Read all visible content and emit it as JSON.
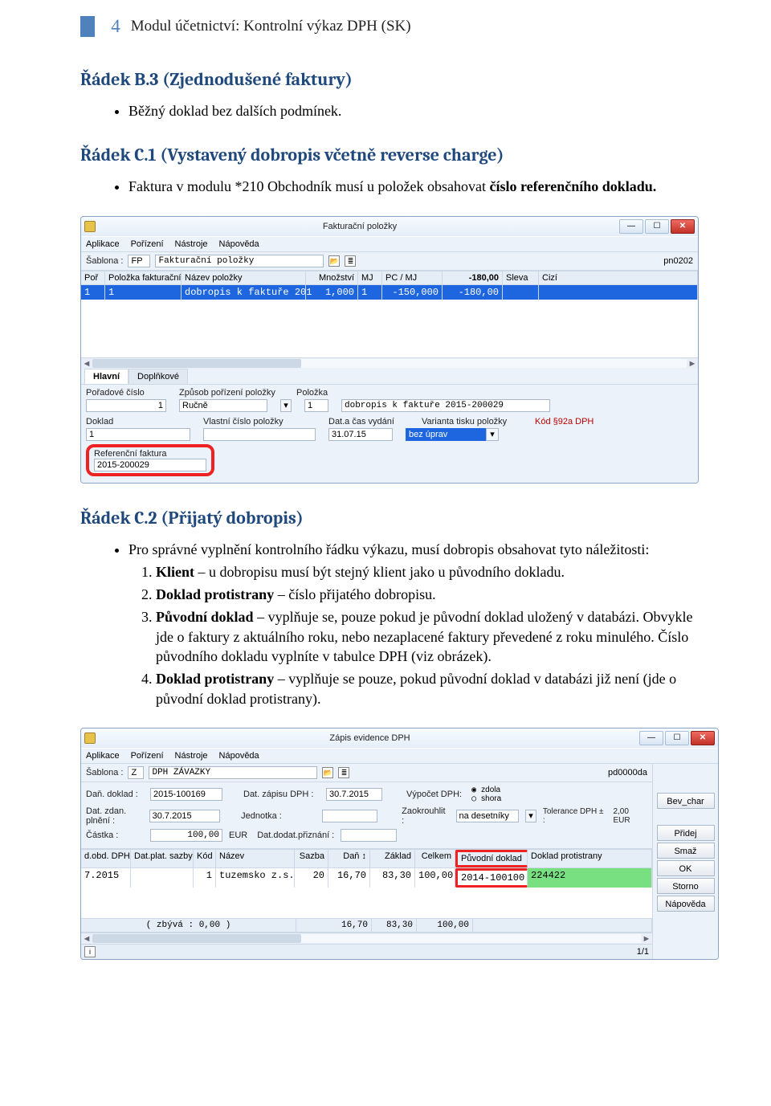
{
  "header": {
    "page_num": "4",
    "title": "Modul účetnictví: Kontrolní výkaz DPH (SK)"
  },
  "section_b3": {
    "title": "Řádek B.3 (Zjednodušené faktury)",
    "bullet": "Běžný doklad bez dalších podmínek."
  },
  "section_c1": {
    "title": "Řádek C.1 (Vystavený dobropis včetně reverse charge)",
    "bullet_pre": "Faktura v modulu *210 Obchodník musí u položek obsahovat ",
    "bullet_bold": "číslo referenčního dokladu."
  },
  "win1": {
    "title": "Fakturační položky",
    "menus": [
      "Aplikace",
      "Pořízení",
      "Nástroje",
      "Nápověda"
    ],
    "template_lbl": "Šablona :",
    "template_code": "FP",
    "template_name": "Fakturační položky",
    "tag": "pn0202",
    "cols": [
      "Poř",
      "Položka fakturační",
      "Název položky",
      "Množství",
      "MJ",
      "PC / MJ",
      "-180,00",
      "Sleva",
      "Cizí"
    ],
    "row": [
      "1",
      "1",
      "dobropis  k faktuře 201",
      "1,000",
      "1",
      "-150,000",
      "-180,00",
      "",
      ""
    ],
    "tabs": [
      "Hlavní",
      "Doplňkové"
    ],
    "fields": {
      "poradove_cislo_lbl": "Pořadové číslo",
      "poradove_cislo_val": "1",
      "zpusob_lbl": "Způsob pořízení položky",
      "zpusob_val": "Ručně",
      "polozka_lbl": "Položka",
      "polozka_val": "1",
      "polozka_text": "dobropis  k faktuře 2015-200029",
      "doklad_lbl": "Doklad",
      "doklad_val": "1",
      "vlastni_cislo_lbl": "Vlastní číslo položky",
      "dat_lbl": "Dat.a čas vydání",
      "dat_val": "31.07.15",
      "varianta_lbl": "Varianta tisku položky",
      "varianta_val": "bez úprav",
      "kod_lbl": "Kód §92a DPH",
      "ref_lbl": "Referenční faktura",
      "ref_val": "2015-200029"
    }
  },
  "section_c2": {
    "title": "Řádek C.2 (Přijatý dobropis)",
    "intro": "Pro správné vyplnění kontrolního řádku výkazu, musí dobropis obsahovat tyto náležitosti:",
    "items": [
      {
        "b": "Klient",
        "rest": " – u dobropisu musí být stejný klient jako u původního dokladu."
      },
      {
        "b": "Doklad protistrany",
        "rest": " – číslo přijatého dobropisu."
      },
      {
        "b": "Původní doklad",
        "rest": " – vyplňuje se, pouze pokud je původní doklad uložený v databázi. Obvykle jde o faktury z aktuálního roku, nebo nezaplacené faktury převedené z roku minulého. Číslo původního dokladu vyplníte v tabulce DPH (viz obrázek)."
      },
      {
        "b": "Doklad protistrany",
        "rest": " – vyplňuje se pouze, pokud původní doklad v databázi již není (jde o původní doklad protistrany)."
      }
    ]
  },
  "win2": {
    "title": "Zápis evidence DPH",
    "menus": [
      "Aplikace",
      "Pořízení",
      "Nástroje",
      "Nápověda"
    ],
    "template_lbl": "Šablona :",
    "template_code": "Z",
    "template_name": "DPH ZÁVAZKY",
    "tag": "pd0000da",
    "row1": {
      "dandoklad_lbl": "Daň. doklad :",
      "dandoklad_val": "2015-100169",
      "datzapisu_lbl": "Dat. zápisu DPH :",
      "datzapisu_val": "30.7.2015",
      "vypocet_lbl": "Výpočet DPH:",
      "opt1": "zdola",
      "opt2": "shora"
    },
    "row2": {
      "datzdan_lbl": "Dat. zdan. plnění :",
      "datzdan_val": "30.7.2015",
      "jednotka_lbl": "Jednotka :",
      "zaokr_lbl": "Zaokrouhlit :",
      "zaokr_val": "na desetníky",
      "tol_lbl": "Tolerance DPH ± :",
      "tol_val": "2,00 EUR"
    },
    "row3": {
      "castka_lbl": "Částka :",
      "castka_val": "100,00",
      "castka_cur": "EUR",
      "datdodat_lbl": "Dat.dodat.přiznání :"
    },
    "grid_cols": [
      "d.obd. DPH",
      "Dat.plat. sazby",
      "Kód",
      "Název",
      "Sazba",
      "Daň",
      "Základ",
      "Celkem",
      "Původní doklad",
      "Doklad protistrany"
    ],
    "grid_row": [
      "7.2015",
      "",
      "1",
      "tuzemsko z.s.",
      "20",
      "16,70",
      "83,30",
      "100,00",
      "2014-100100",
      "224422"
    ],
    "footer": [
      "( zbývá : 0,00 )",
      "16,70",
      "83,30",
      "100,00"
    ],
    "buttons": [
      "Bev_char",
      "Přidej",
      "Smaž",
      "OK",
      "Storno",
      "Nápověda"
    ],
    "status": "1/1"
  }
}
